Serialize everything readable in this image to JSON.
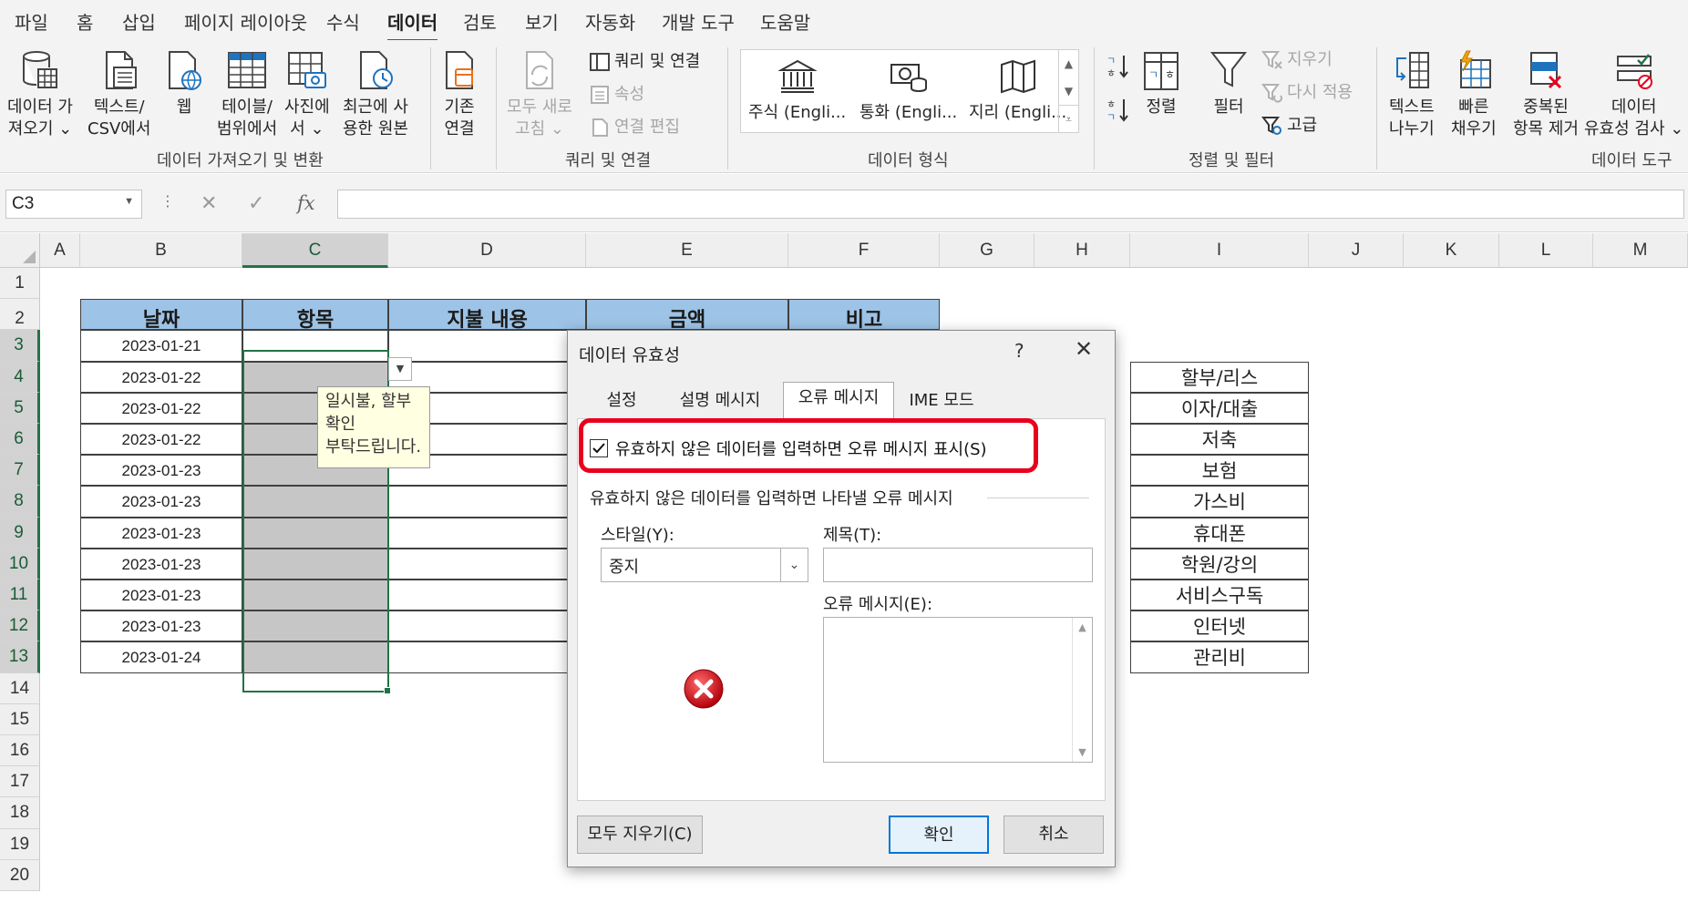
{
  "ribbon_tabs": [
    "파일",
    "홈",
    "삽입",
    "페이지 레이아웃",
    "수식",
    "데이터",
    "검토",
    "보기",
    "자동화",
    "개발 도구",
    "도움말"
  ],
  "active_tab": "데이터",
  "ribbon": {
    "get_data": [
      "데이터 가",
      "져오기 ⌄"
    ],
    "text_csv": [
      "텍스트/",
      "CSV에서"
    ],
    "web": [
      "웹",
      ""
    ],
    "from_table": [
      "테이블/",
      "범위에서"
    ],
    "from_picture": [
      "사진에",
      "서 ⌄"
    ],
    "recent_sources": [
      "최근에 사",
      "용한 원본"
    ],
    "existing_conn": [
      "기존",
      "연결"
    ],
    "refresh_all": [
      "모두 새로",
      "고침 ⌄"
    ],
    "queries_conn": "쿼리 및 연결",
    "properties": "속성",
    "edit_links": "연결 편집",
    "stocks": "주식 (Engli...",
    "currencies": "통화 (Engli...",
    "geography": "지리 (Engli...",
    "sort_label": "정렬",
    "filter_label": "필터",
    "clear": "지우기",
    "reapply": "다시 적용",
    "advanced": "고급",
    "text_to_columns": [
      "텍스트",
      "나누기"
    ],
    "flash_fill": [
      "빠른",
      "채우기"
    ],
    "remove_dup": [
      "중복된",
      "항목 제거"
    ],
    "data_validation": [
      "데이터",
      "유효성 검사 ⌄"
    ],
    "groups": {
      "get_transform": "데이터 가져오기 및 변환",
      "queries": "쿼리 및 연결",
      "data_types": "데이터 형식",
      "sort_filter": "정렬 및 필터",
      "data_tools": "데이터 도구"
    }
  },
  "namebox": "C3",
  "fx": "fx",
  "columns": [
    "A",
    "B",
    "C",
    "D",
    "E",
    "F",
    "G",
    "H",
    "I",
    "J",
    "K",
    "L",
    "M"
  ],
  "rows": [
    "1",
    "2",
    "3",
    "4",
    "5",
    "6",
    "7",
    "8",
    "9",
    "10",
    "11",
    "12",
    "13",
    "14",
    "15",
    "16",
    "17",
    "18",
    "19",
    "20"
  ],
  "table": {
    "headers": [
      "날짜",
      "항목",
      "지불 내용",
      "금액",
      "비고"
    ],
    "dates": [
      "2023-01-21",
      "2023-01-22",
      "2023-01-22",
      "2023-01-22",
      "2023-01-23",
      "2023-01-23",
      "2023-01-23",
      "2023-01-23",
      "2023-01-23",
      "2023-01-23",
      "2023-01-24"
    ]
  },
  "category_list": [
    "할부/리스",
    "이자/대출",
    "저축",
    "보험",
    "가스비",
    "휴대폰",
    "학원/강의",
    "서비스구독",
    "인터넷",
    "관리비"
  ],
  "tooltip": [
    "일시불, 할부",
    "확인",
    "부탁드립니다."
  ],
  "dialog": {
    "title": "데이터 유효성",
    "help": "?",
    "tabs": [
      "설정",
      "설명 메시지",
      "오류 메시지",
      "IME 모드"
    ],
    "active_tab": "오류 메시지",
    "checkbox_label": "유효하지 않은 데이터를 입력하면 오류 메시지 표시(S)",
    "checkbox_checked": true,
    "section_title": "유효하지 않은 데이터를 입력하면 나타낼 오류 메시지",
    "style_label": "스타일(Y):",
    "style_value": "중지",
    "title_label": "제목(T):",
    "title_value": "",
    "message_label": "오류 메시지(E):",
    "message_value": "",
    "clear_all": "모두 지우기(C)",
    "ok": "확인",
    "cancel": "취소"
  },
  "colors": {
    "accent": "#217346",
    "header_fill": "#9dc3e6",
    "highlight": "#e8001c",
    "error_icon": "#c0141c"
  }
}
